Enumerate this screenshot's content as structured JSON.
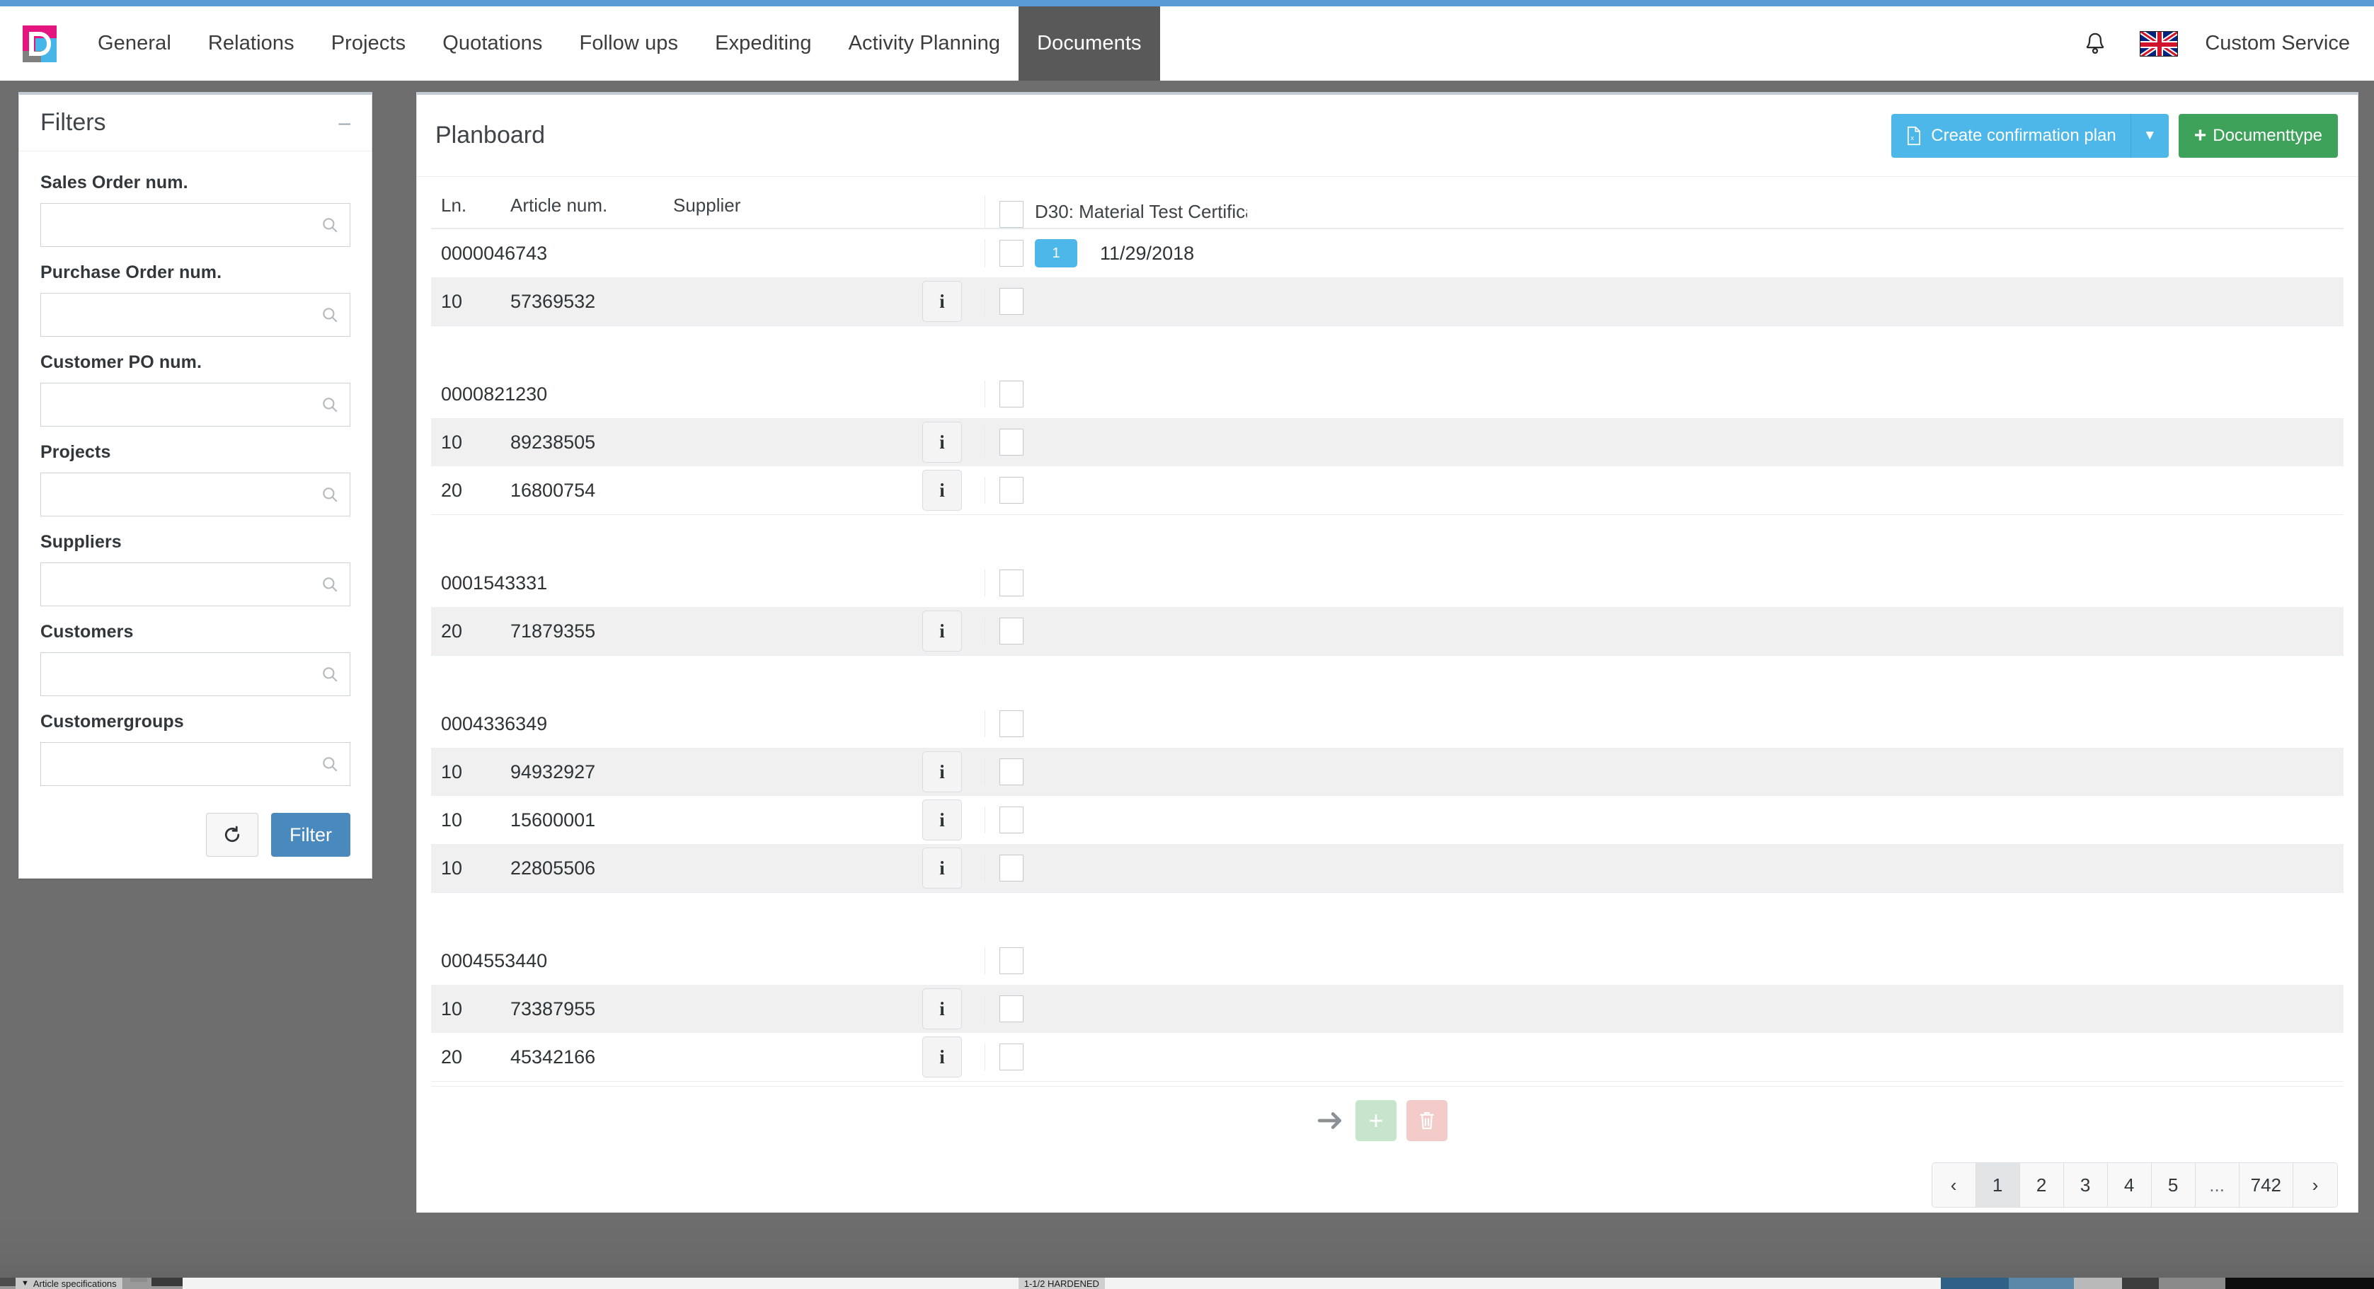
{
  "navbar": {
    "logo_alt": "company-logo",
    "links": [
      {
        "label": "General",
        "active": false
      },
      {
        "label": "Relations",
        "active": false
      },
      {
        "label": "Projects",
        "active": false
      },
      {
        "label": "Quotations",
        "active": false
      },
      {
        "label": "Follow ups",
        "active": false
      },
      {
        "label": "Expediting",
        "active": false
      },
      {
        "label": "Activity Planning",
        "active": false
      },
      {
        "label": "Documents",
        "active": true
      }
    ],
    "bell_icon": "bell-icon",
    "flag_icon": "uk-flag-icon",
    "user": "Custom Service"
  },
  "filters": {
    "title": "Filters",
    "collapse_icon": "minus-icon",
    "fields": [
      {
        "label": "Sales Order num.",
        "value": "",
        "placeholder": ""
      },
      {
        "label": "Purchase Order num.",
        "value": "",
        "placeholder": ""
      },
      {
        "label": "Customer PO num.",
        "value": "",
        "placeholder": ""
      },
      {
        "label": "Projects",
        "value": "",
        "placeholder": ""
      },
      {
        "label": "Suppliers",
        "value": "",
        "placeholder": ""
      },
      {
        "label": "Customers",
        "value": "",
        "placeholder": ""
      },
      {
        "label": "Customergroups",
        "value": "",
        "placeholder": ""
      }
    ],
    "reset_icon": "reset-icon",
    "filter_label": "Filter"
  },
  "board": {
    "title": "Planboard",
    "create_plan_label": "Create confirmation plan",
    "create_plan_icon": "excel-file-icon",
    "create_plan_caret": "caret-down-icon",
    "documenttype_label": "Documenttype",
    "documenttype_icon": "plus-icon",
    "columns": {
      "ln": "Ln.",
      "article": "Article num.",
      "supplier": "Supplier",
      "d30": "D30: Material Test Certifica"
    },
    "groups": [
      {
        "order": "0000046743",
        "badge": "1",
        "date": "11/29/2018",
        "rows": [
          {
            "ln": "10",
            "article": "57369532",
            "supplier": ""
          }
        ]
      },
      {
        "order": "0000821230",
        "badge": "",
        "date": "",
        "rows": [
          {
            "ln": "10",
            "article": "89238505",
            "supplier": ""
          },
          {
            "ln": "20",
            "article": "16800754",
            "supplier": ""
          }
        ]
      },
      {
        "order": "0001543331",
        "badge": "",
        "date": "",
        "rows": [
          {
            "ln": "20",
            "article": "71879355",
            "supplier": ""
          }
        ]
      },
      {
        "order": "0004336349",
        "badge": "",
        "date": "",
        "rows": [
          {
            "ln": "10",
            "article": "94932927",
            "supplier": ""
          },
          {
            "ln": "10",
            "article": "15600001",
            "supplier": ""
          },
          {
            "ln": "10",
            "article": "22805506",
            "supplier": ""
          }
        ]
      },
      {
        "order": "0004553440",
        "badge": "",
        "date": "",
        "rows": [
          {
            "ln": "10",
            "article": "73387955",
            "supplier": ""
          },
          {
            "ln": "20",
            "article": "45342166",
            "supplier": ""
          }
        ]
      }
    ],
    "footer": {
      "arrow_icon": "arrow-right-icon",
      "add_icon": "plus-icon",
      "delete_icon": "trash-icon"
    },
    "pagination": {
      "prev": "‹",
      "next": "›",
      "pages": [
        "1",
        "2",
        "3",
        "4",
        "5",
        "...",
        "742"
      ],
      "current": "1"
    }
  },
  "desktop": {
    "taskbar_app1": "Article specifications",
    "taskbar_app2": "1-1/2 HARDENED"
  },
  "colors": {
    "accent_blue": "#4cb7e8",
    "filter_blue": "#4a89bd",
    "green": "#3fa25a",
    "nav_active": "#595959",
    "browser_strip": "#5b9bd5",
    "logo_pink": "#e5157f",
    "logo_cyan": "#46b6e8"
  }
}
